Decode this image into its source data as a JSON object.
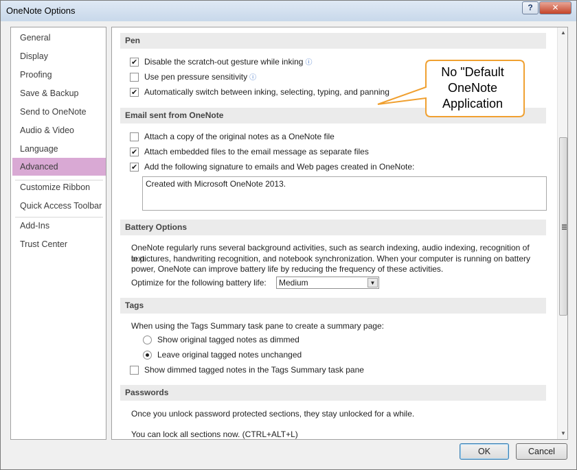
{
  "window": {
    "title": "OneNote Options",
    "help_label": "?",
    "close_label": "✕"
  },
  "sidebar": {
    "items": [
      {
        "label": "General"
      },
      {
        "label": "Display"
      },
      {
        "label": "Proofing"
      },
      {
        "label": "Save & Backup"
      },
      {
        "label": "Send to OneNote"
      },
      {
        "label": "Audio & Video"
      },
      {
        "label": "Language"
      },
      {
        "label": "Advanced",
        "active": true
      },
      {
        "label": "Customize Ribbon"
      },
      {
        "label": "Quick Access Toolbar"
      },
      {
        "label": "Add-Ins"
      },
      {
        "label": "Trust Center"
      }
    ]
  },
  "pen": {
    "heading": "Pen",
    "options": [
      {
        "label": "Disable the scratch-out gesture while inking",
        "checked": true,
        "info": true
      },
      {
        "label": "Use pen pressure sensitivity",
        "checked": false,
        "info": true
      },
      {
        "label": "Automatically switch between inking, selecting, typing, and panning",
        "checked": true
      }
    ]
  },
  "email": {
    "heading": "Email sent from OneNote",
    "options": [
      {
        "label": "Attach a copy of the original notes as a OneNote file",
        "checked": false
      },
      {
        "label": "Attach embedded files to the email message as separate files",
        "checked": true
      },
      {
        "label": "Add the following signature to emails and Web pages created in OneNote:",
        "checked": true
      }
    ],
    "signature": "Created with Microsoft OneNote 2013."
  },
  "battery": {
    "heading": "Battery Options",
    "description_lines": [
      "OneNote regularly runs several background activities, such as search indexing, audio indexing, recognition of text",
      "in pictures, handwriting recognition, and notebook synchronization. When your computer is running on battery",
      "power, OneNote can improve battery life by reducing the frequency of these activities."
    ],
    "optimize_label": "Optimize for the following battery life:",
    "optimize_value": "Medium"
  },
  "tags": {
    "heading": "Tags",
    "intro": "When using the Tags Summary task pane to create a summary page:",
    "radios": [
      {
        "label": "Show original tagged notes as dimmed",
        "selected": false
      },
      {
        "label": "Leave original tagged notes unchanged",
        "selected": true
      }
    ],
    "dimmed_option": {
      "label": "Show dimmed tagged notes in the Tags Summary task pane",
      "checked": false
    }
  },
  "passwords": {
    "heading": "Passwords",
    "line1": "Once you unlock password protected sections, they stay unlocked for a while.",
    "line2": "You can lock all sections now. (CTRL+ALT+L)"
  },
  "callout": {
    "lines": [
      "No \"Default",
      "OneNote",
      "Application"
    ],
    "border_color": "#f0a030"
  },
  "footer": {
    "ok_label": "OK",
    "cancel_label": "Cancel"
  },
  "colors": {
    "active_nav": "#d9a9d4",
    "section_bg": "#ebebeb"
  }
}
